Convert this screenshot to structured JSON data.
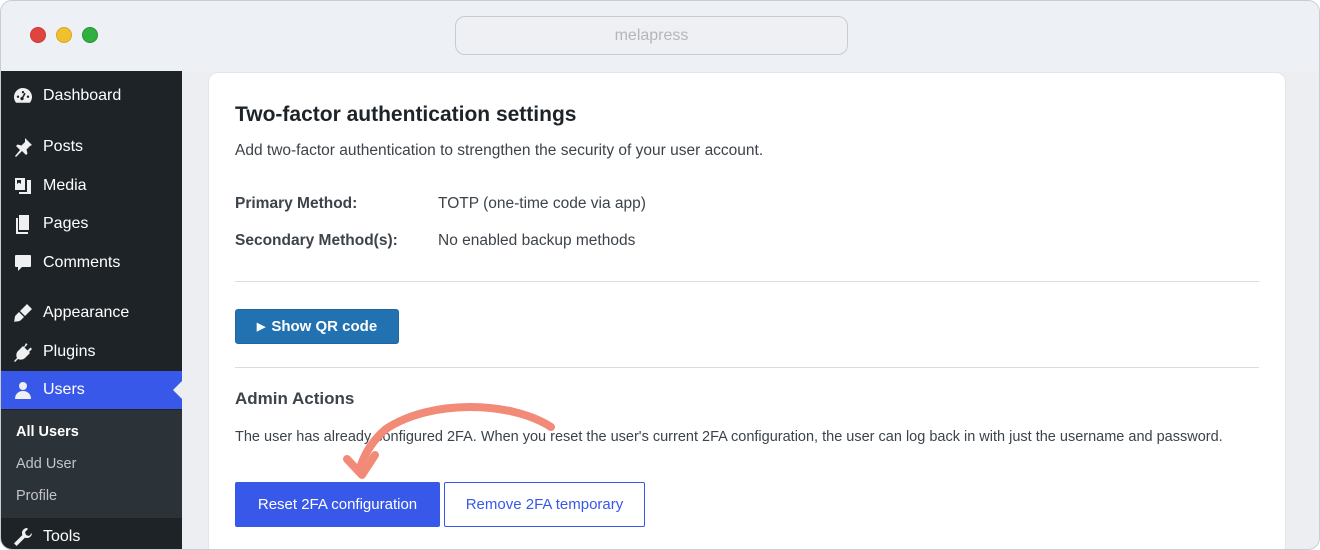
{
  "browser": {
    "url": "melapress"
  },
  "sidebar": {
    "items": [
      {
        "label": "Dashboard",
        "icon": "dashboard-icon"
      },
      {
        "label": "Posts",
        "icon": "pin-icon"
      },
      {
        "label": "Media",
        "icon": "media-icon"
      },
      {
        "label": "Pages",
        "icon": "pages-icon"
      },
      {
        "label": "Comments",
        "icon": "comment-icon"
      },
      {
        "label": "Appearance",
        "icon": "brush-icon"
      },
      {
        "label": "Plugins",
        "icon": "plugin-icon"
      },
      {
        "label": "Users",
        "icon": "user-icon",
        "active": true
      },
      {
        "label": "Tools",
        "icon": "wrench-icon"
      }
    ],
    "submenu": [
      "All Users",
      "Add User",
      "Profile"
    ]
  },
  "main": {
    "title": "Two-factor authentication settings",
    "subtitle": "Add two-factor authentication to strengthen the security of your user account.",
    "primary_label": "Primary Method:",
    "primary_value": "TOTP (one-time code via app)",
    "secondary_label": "Secondary Method(s):",
    "secondary_value": "No enabled backup methods",
    "qr_button": "Show QR code",
    "qr_button_icon": "play-icon",
    "admin_title": "Admin Actions",
    "admin_desc": "The user has already configured 2FA. When you reset the user's current 2FA configuration, the user can log back in with just the username and password.",
    "reset_button": "Reset 2FA configuration",
    "remove_button": "Remove 2FA temporary"
  },
  "colors": {
    "accent": "#3858e9",
    "wp_blue": "#2271b1",
    "sidebar": "#1d2327",
    "annotation": "#f28a78"
  }
}
